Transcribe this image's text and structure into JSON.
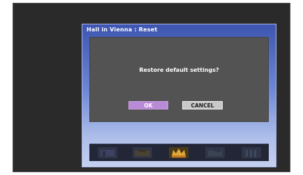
{
  "window": {
    "title": "Hall in Vienna : Reset"
  },
  "dialog": {
    "message": "Restore default settings?",
    "ok_label": "OK",
    "cancel_label": "CANCEL",
    "selected": "OK"
  },
  "thumbnails": [
    {
      "icon": "room-thumb-icon",
      "active": false
    },
    {
      "icon": "room-thumb-icon",
      "active": false
    },
    {
      "icon": "hall-crown-icon",
      "active": true
    },
    {
      "icon": "room-thumb-icon",
      "active": false
    },
    {
      "icon": "room-thumb-icon",
      "active": false
    }
  ],
  "colors": {
    "ok_selected": "#b98ad6",
    "cancel": "#c8c8c8",
    "panel": "#535353",
    "frame_top": "#3d55b0"
  }
}
